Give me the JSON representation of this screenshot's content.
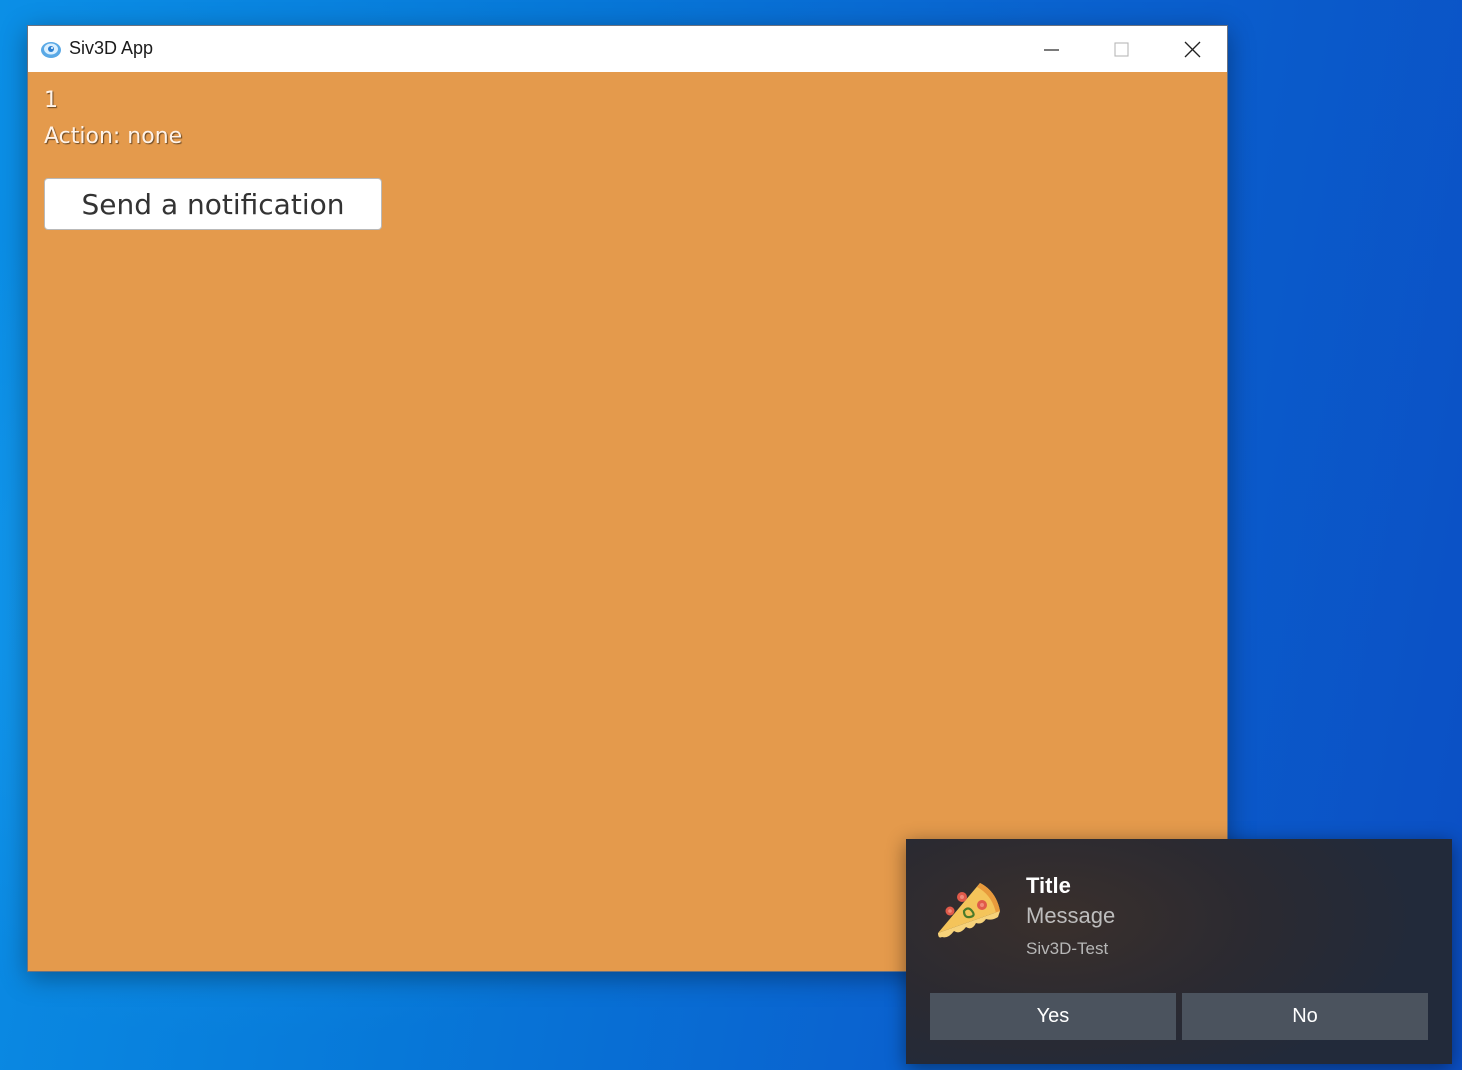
{
  "window": {
    "title": "Siv3D App",
    "app_icon": "siv3d-icon",
    "controls": {
      "minimize_icon": "minimize-icon",
      "maximize_icon": "maximize-icon",
      "close_icon": "close-icon"
    },
    "background_color": "#e49a4c"
  },
  "content": {
    "counter": "1",
    "action_label": "Action: none",
    "send_button_label": "Send a notification"
  },
  "notification": {
    "icon": "pizza-icon",
    "title": "Title",
    "message": "Message",
    "source": "Siv3D-Test",
    "buttons": {
      "yes_label": "Yes",
      "no_label": "No"
    }
  }
}
